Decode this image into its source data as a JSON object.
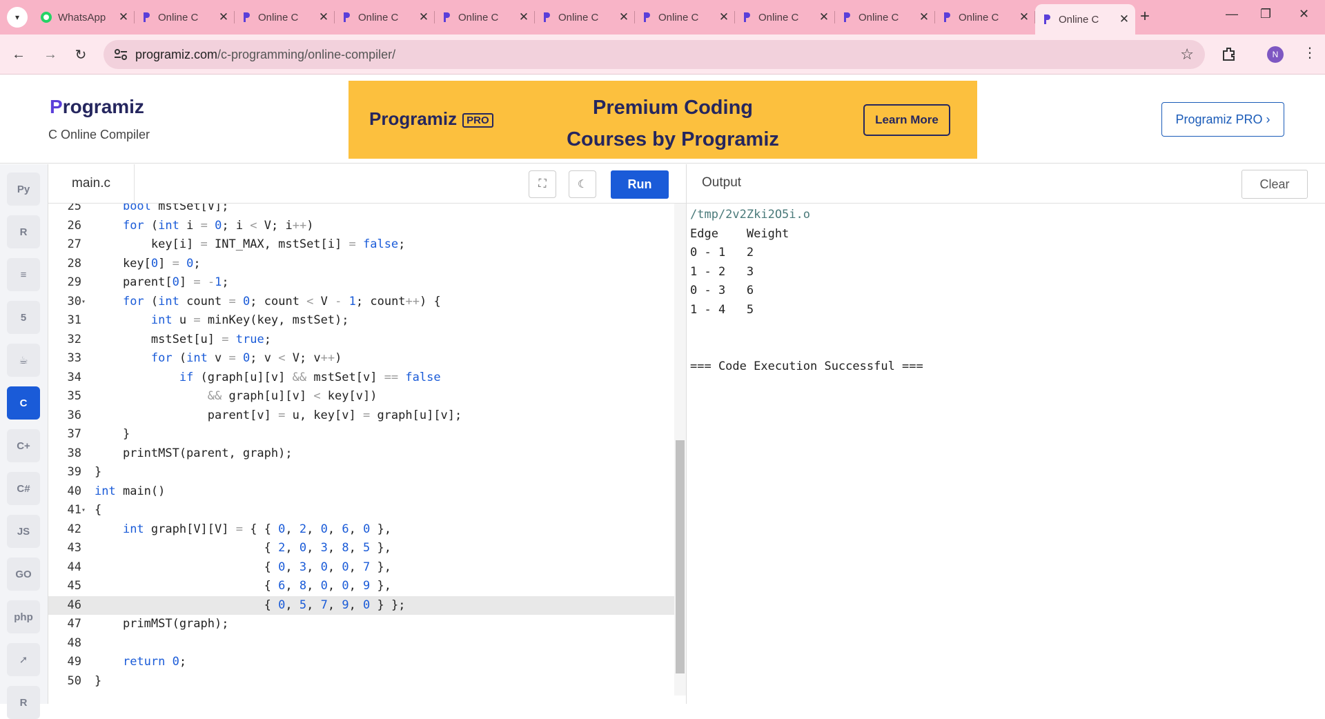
{
  "browser": {
    "tabs": [
      {
        "label": "WhatsApp",
        "icon": "whatsapp-icon",
        "active": false
      },
      {
        "label": "Online C",
        "icon": "programiz-icon",
        "active": false
      },
      {
        "label": "Online C",
        "icon": "programiz-icon",
        "active": false
      },
      {
        "label": "Online C",
        "icon": "programiz-icon",
        "active": false
      },
      {
        "label": "Online C",
        "icon": "programiz-icon",
        "active": false
      },
      {
        "label": "Online C",
        "icon": "programiz-icon",
        "active": false
      },
      {
        "label": "Online C",
        "icon": "programiz-icon",
        "active": false
      },
      {
        "label": "Online C",
        "icon": "programiz-icon",
        "active": false
      },
      {
        "label": "Online C",
        "icon": "programiz-icon",
        "active": false
      },
      {
        "label": "Online C",
        "icon": "programiz-icon",
        "active": false
      },
      {
        "label": "Online C",
        "icon": "programiz-icon",
        "active": true
      }
    ],
    "url_host": "programiz.com",
    "url_path": "/c-programming/online-compiler/",
    "profile_initial": "N",
    "tab_bar_color": "#f8b4c7"
  },
  "header": {
    "logo_text": "rogramiz",
    "logo_letter": "P",
    "subtitle": "C Online Compiler",
    "banner": {
      "logo_text": "rogramiz",
      "logo_letter": "P",
      "pro_badge": "PRO",
      "title_line1": "Premium Coding",
      "title_line2": "Courses by Programiz",
      "button": "Learn More",
      "background": "#fcc03e"
    },
    "pro_button": "Programiz PRO ›"
  },
  "sidebar": {
    "languages": [
      {
        "name": "python-icon",
        "glyph": "Py",
        "active": false
      },
      {
        "name": "r-icon",
        "glyph": "R",
        "active": false
      },
      {
        "name": "sql-icon",
        "glyph": "≡",
        "active": false
      },
      {
        "name": "html-icon",
        "glyph": "5",
        "active": false
      },
      {
        "name": "java-icon",
        "glyph": "☕",
        "active": false
      },
      {
        "name": "c-icon",
        "glyph": "C",
        "active": true
      },
      {
        "name": "cpp-icon",
        "glyph": "C+",
        "active": false
      },
      {
        "name": "csharp-icon",
        "glyph": "C#",
        "active": false
      },
      {
        "name": "javascript-icon",
        "glyph": "JS",
        "active": false
      },
      {
        "name": "go-icon",
        "glyph": "GO",
        "active": false
      },
      {
        "name": "php-icon",
        "glyph": "php",
        "active": false
      },
      {
        "name": "swift-icon",
        "glyph": "➚",
        "active": false
      },
      {
        "name": "rust-icon",
        "glyph": "R",
        "active": false
      }
    ]
  },
  "editor": {
    "file_name": "main.c",
    "run_label": "Run",
    "accent": "#1a5bd8",
    "highlighted_line": 46,
    "lines": [
      {
        "n": "25",
        "fold": false,
        "code": "    bool mstSet[V];"
      },
      {
        "n": "26",
        "fold": false,
        "code": "    for (int i = 0; i < V; i++)"
      },
      {
        "n": "27",
        "fold": false,
        "code": "        key[i] = INT_MAX, mstSet[i] = false;"
      },
      {
        "n": "28",
        "fold": false,
        "code": "    key[0] = 0;"
      },
      {
        "n": "29",
        "fold": false,
        "code": "    parent[0] = -1;"
      },
      {
        "n": "30",
        "fold": true,
        "code": "    for (int count = 0; count < V - 1; count++) {"
      },
      {
        "n": "31",
        "fold": false,
        "code": "        int u = minKey(key, mstSet);"
      },
      {
        "n": "32",
        "fold": false,
        "code": "        mstSet[u] = true;"
      },
      {
        "n": "33",
        "fold": false,
        "code": "        for (int v = 0; v < V; v++)"
      },
      {
        "n": "34",
        "fold": false,
        "code": "            if (graph[u][v] && mstSet[v] == false"
      },
      {
        "n": "35",
        "fold": false,
        "code": "                && graph[u][v] < key[v])"
      },
      {
        "n": "36",
        "fold": false,
        "code": "                parent[v] = u, key[v] = graph[u][v];"
      },
      {
        "n": "37",
        "fold": false,
        "code": "    }"
      },
      {
        "n": "38",
        "fold": false,
        "code": "    printMST(parent, graph);"
      },
      {
        "n": "39",
        "fold": false,
        "code": "}"
      },
      {
        "n": "40",
        "fold": false,
        "code": "int main()"
      },
      {
        "n": "41",
        "fold": true,
        "code": "{"
      },
      {
        "n": "42",
        "fold": false,
        "code": "    int graph[V][V] = { { 0, 2, 0, 6, 0 },"
      },
      {
        "n": "43",
        "fold": false,
        "code": "                        { 2, 0, 3, 8, 5 },"
      },
      {
        "n": "44",
        "fold": false,
        "code": "                        { 0, 3, 0, 0, 7 },"
      },
      {
        "n": "45",
        "fold": false,
        "code": "                        { 6, 8, 0, 0, 9 },"
      },
      {
        "n": "46",
        "fold": false,
        "code": "                        { 0, 5, 7, 9, 0 } };"
      },
      {
        "n": "47",
        "fold": false,
        "code": "    primMST(graph);"
      },
      {
        "n": "48",
        "fold": false,
        "code": ""
      },
      {
        "n": "49",
        "fold": false,
        "code": "    return 0;"
      },
      {
        "n": "50",
        "fold": false,
        "code": "}"
      }
    ]
  },
  "output": {
    "label": "Output",
    "clear_label": "Clear",
    "lines": [
      "/tmp/2v2Zki2O5i.o",
      "Edge    Weight",
      "0 - 1   2",
      "1 - 2   3",
      "0 - 3   6",
      "1 - 4   5",
      "",
      "",
      "=== Code Execution Successful ==="
    ]
  }
}
